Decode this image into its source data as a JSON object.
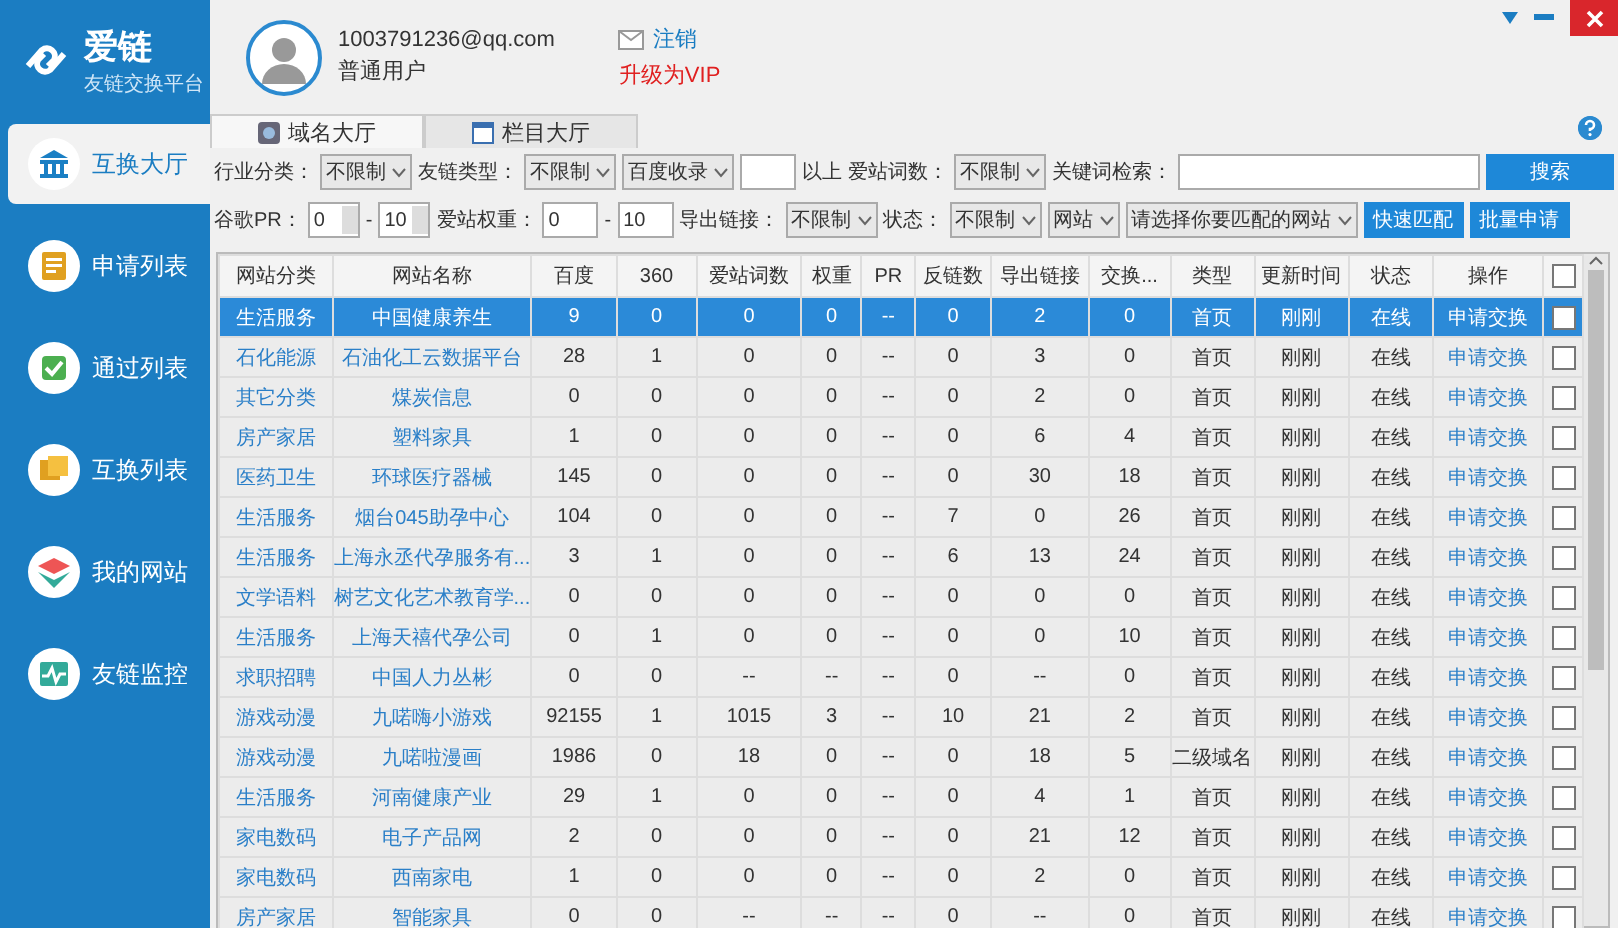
{
  "brand": {
    "name": "爱链",
    "tagline": "友链交换平台"
  },
  "sidebar": {
    "items": [
      {
        "label": "互换大厅",
        "selected": true
      },
      {
        "label": "申请列表",
        "selected": false
      },
      {
        "label": "通过列表",
        "selected": false
      },
      {
        "label": "互换列表",
        "selected": false
      },
      {
        "label": "我的网站",
        "selected": false
      },
      {
        "label": "友链监控",
        "selected": false
      }
    ]
  },
  "user": {
    "email": "1003791236@qq.com",
    "role": "普通用户",
    "logout": "注销",
    "upgrade": "升级为VIP"
  },
  "tabs": [
    {
      "label": "域名大厅",
      "selected": true
    },
    {
      "label": "栏目大厅",
      "selected": false
    }
  ],
  "filters": [
    [
      {
        "kind": "label",
        "text": "行业分类："
      },
      {
        "kind": "select",
        "value": "不限制"
      },
      {
        "kind": "label",
        "text": "友链类型："
      },
      {
        "kind": "select",
        "value": "不限制"
      },
      {
        "kind": "select",
        "value": "百度收录"
      },
      {
        "kind": "input"
      },
      {
        "kind": "label",
        "text": "以上"
      },
      {
        "kind": "label",
        "text": "爱站词数："
      },
      {
        "kind": "select",
        "value": "不限制"
      },
      {
        "kind": "label",
        "text": "关键词检索："
      },
      {
        "kind": "search"
      },
      {
        "kind": "button",
        "text": "搜索"
      }
    ],
    [
      {
        "kind": "label",
        "text": "谷歌PR："
      },
      {
        "kind": "spin",
        "value": "0"
      },
      {
        "kind": "label",
        "text": "-"
      },
      {
        "kind": "spin",
        "value": "10"
      },
      {
        "kind": "label",
        "text": "爱站权重："
      },
      {
        "kind": "input",
        "value": "0"
      },
      {
        "kind": "label",
        "text": "-"
      },
      {
        "kind": "input",
        "value": "10"
      },
      {
        "kind": "label",
        "text": "导出链接："
      },
      {
        "kind": "select",
        "value": "不限制"
      },
      {
        "kind": "label",
        "text": "状态："
      },
      {
        "kind": "select",
        "value": "不限制"
      },
      {
        "kind": "select",
        "value": "网站"
      },
      {
        "kind": "select",
        "value": "请选择你要匹配的网站"
      },
      {
        "kind": "button",
        "text": "快速匹配"
      },
      {
        "kind": "button",
        "text": "批量申请"
      }
    ]
  ],
  "table": {
    "columns": [
      "网站分类",
      "网站名称",
      "百度",
      "360",
      "爱站词数",
      "权重",
      "PR",
      "反链数",
      "导出链接",
      "交换...",
      "类型",
      "更新时间",
      "状态",
      "操作"
    ],
    "header_checked": false,
    "rows": [
      {
        "selected": true,
        "checked": false,
        "cells": [
          "生活服务",
          "中国健康养生",
          "9",
          "0",
          "0",
          "0",
          "--",
          "0",
          "2",
          "0",
          "首页",
          "刚刚",
          "在线",
          "申请交换"
        ]
      },
      {
        "selected": false,
        "checked": false,
        "cells": [
          "石化能源",
          "石油化工云数据平台",
          "28",
          "1",
          "0",
          "0",
          "--",
          "0",
          "3",
          "0",
          "首页",
          "刚刚",
          "在线",
          "申请交换"
        ]
      },
      {
        "selected": false,
        "checked": false,
        "cells": [
          "其它分类",
          "煤炭信息",
          "0",
          "0",
          "0",
          "0",
          "--",
          "0",
          "2",
          "0",
          "首页",
          "刚刚",
          "在线",
          "申请交换"
        ]
      },
      {
        "selected": false,
        "checked": false,
        "cells": [
          "房产家居",
          "塑料家具",
          "1",
          "0",
          "0",
          "0",
          "--",
          "0",
          "6",
          "4",
          "首页",
          "刚刚",
          "在线",
          "申请交换"
        ]
      },
      {
        "selected": false,
        "checked": false,
        "cells": [
          "医药卫生",
          "环球医疗器械",
          "145",
          "0",
          "0",
          "0",
          "--",
          "0",
          "30",
          "18",
          "首页",
          "刚刚",
          "在线",
          "申请交换"
        ]
      },
      {
        "selected": false,
        "checked": false,
        "cells": [
          "生活服务",
          "烟台045助孕中心",
          "104",
          "0",
          "0",
          "0",
          "--",
          "7",
          "0",
          "26",
          "首页",
          "刚刚",
          "在线",
          "申请交换"
        ]
      },
      {
        "selected": false,
        "checked": false,
        "cells": [
          "生活服务",
          "上海永丞代孕服务有...",
          "3",
          "1",
          "0",
          "0",
          "--",
          "6",
          "13",
          "24",
          "首页",
          "刚刚",
          "在线",
          "申请交换"
        ]
      },
      {
        "selected": false,
        "checked": false,
        "cells": [
          "文学语料",
          "树艺文化艺术教育学...",
          "0",
          "0",
          "0",
          "0",
          "--",
          "0",
          "0",
          "0",
          "首页",
          "刚刚",
          "在线",
          "申请交换"
        ]
      },
      {
        "selected": false,
        "checked": false,
        "cells": [
          "生活服务",
          "上海天禧代孕公司",
          "0",
          "1",
          "0",
          "0",
          "--",
          "0",
          "0",
          "10",
          "首页",
          "刚刚",
          "在线",
          "申请交换"
        ]
      },
      {
        "selected": false,
        "checked": false,
        "cells": [
          "求职招聘",
          "中国人力丛彬",
          "0",
          "0",
          "--",
          "--",
          "--",
          "0",
          "--",
          "0",
          "首页",
          "刚刚",
          "在线",
          "申请交换"
        ]
      },
      {
        "selected": false,
        "checked": false,
        "cells": [
          "游戏动漫",
          "九喏嗨小游戏",
          "92155",
          "1",
          "1015",
          "3",
          "--",
          "10",
          "21",
          "2",
          "首页",
          "刚刚",
          "在线",
          "申请交换"
        ]
      },
      {
        "selected": false,
        "checked": false,
        "cells": [
          "游戏动漫",
          "九喏啦漫画",
          "1986",
          "0",
          "18",
          "0",
          "--",
          "0",
          "18",
          "5",
          "二级域名",
          "刚刚",
          "在线",
          "申请交换"
        ]
      },
      {
        "selected": false,
        "checked": false,
        "cells": [
          "生活服务",
          "河南健康产业",
          "29",
          "1",
          "0",
          "0",
          "--",
          "0",
          "4",
          "1",
          "首页",
          "刚刚",
          "在线",
          "申请交换"
        ]
      },
      {
        "selected": false,
        "checked": false,
        "cells": [
          "家电数码",
          "电子产品网",
          "2",
          "0",
          "0",
          "0",
          "--",
          "0",
          "21",
          "12",
          "首页",
          "刚刚",
          "在线",
          "申请交换"
        ]
      },
      {
        "selected": false,
        "checked": false,
        "cells": [
          "家电数码",
          "西南家电",
          "1",
          "0",
          "0",
          "0",
          "--",
          "0",
          "2",
          "0",
          "首页",
          "刚刚",
          "在线",
          "申请交换"
        ]
      },
      {
        "selected": false,
        "checked": false,
        "cells": [
          "房产家居",
          "智能家具",
          "0",
          "0",
          "--",
          "--",
          "--",
          "0",
          "--",
          "0",
          "首页",
          "刚刚",
          "在线",
          "申请交换"
        ]
      }
    ]
  }
}
